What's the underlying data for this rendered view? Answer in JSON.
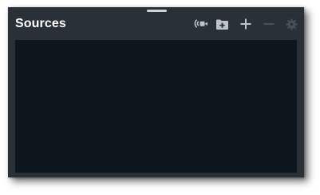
{
  "dock": {
    "title": "Sources"
  },
  "toolbar": {
    "items": [
      {
        "icon": "virtual-camera-icon",
        "enabled": true
      },
      {
        "icon": "add-folder-icon",
        "enabled": true
      },
      {
        "icon": "plus-icon",
        "enabled": true
      },
      {
        "icon": "minus-icon",
        "enabled": false
      },
      {
        "icon": "gear-icon",
        "enabled": false
      }
    ]
  },
  "colors": {
    "panel_bg": "#2a3038",
    "list_bg": "#0d161c",
    "icon_enabled": "#bfc4ca",
    "icon_disabled": "#4a5058",
    "title": "#ffffff"
  }
}
